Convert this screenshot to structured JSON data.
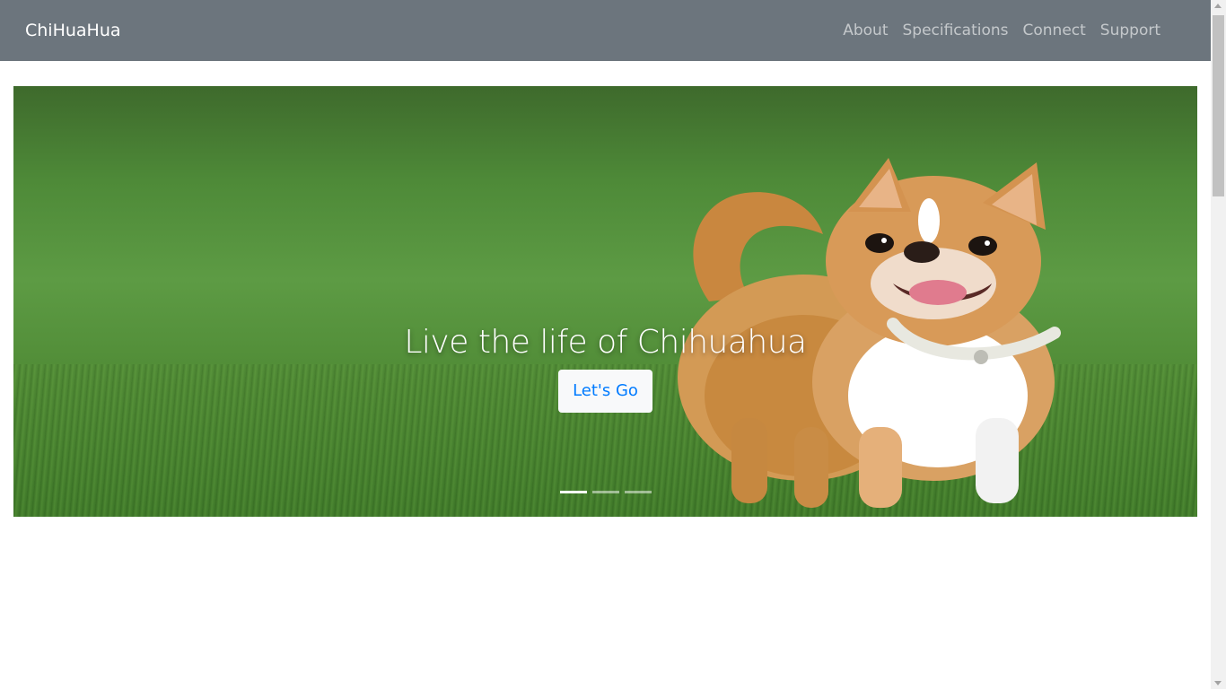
{
  "navbar": {
    "brand": "ChiHuaHua",
    "links": [
      {
        "label": "About"
      },
      {
        "label": "Specifications"
      },
      {
        "label": "Connect"
      },
      {
        "label": "Support"
      }
    ],
    "background_color": "#6c757d"
  },
  "hero": {
    "image_subject": "chihuahua-dog-on-grass",
    "headline": "Live the life of Chihuahua",
    "button_label": "Let's Go",
    "slide_count": 3,
    "active_slide": 1,
    "button_text_color": "#007bff"
  }
}
